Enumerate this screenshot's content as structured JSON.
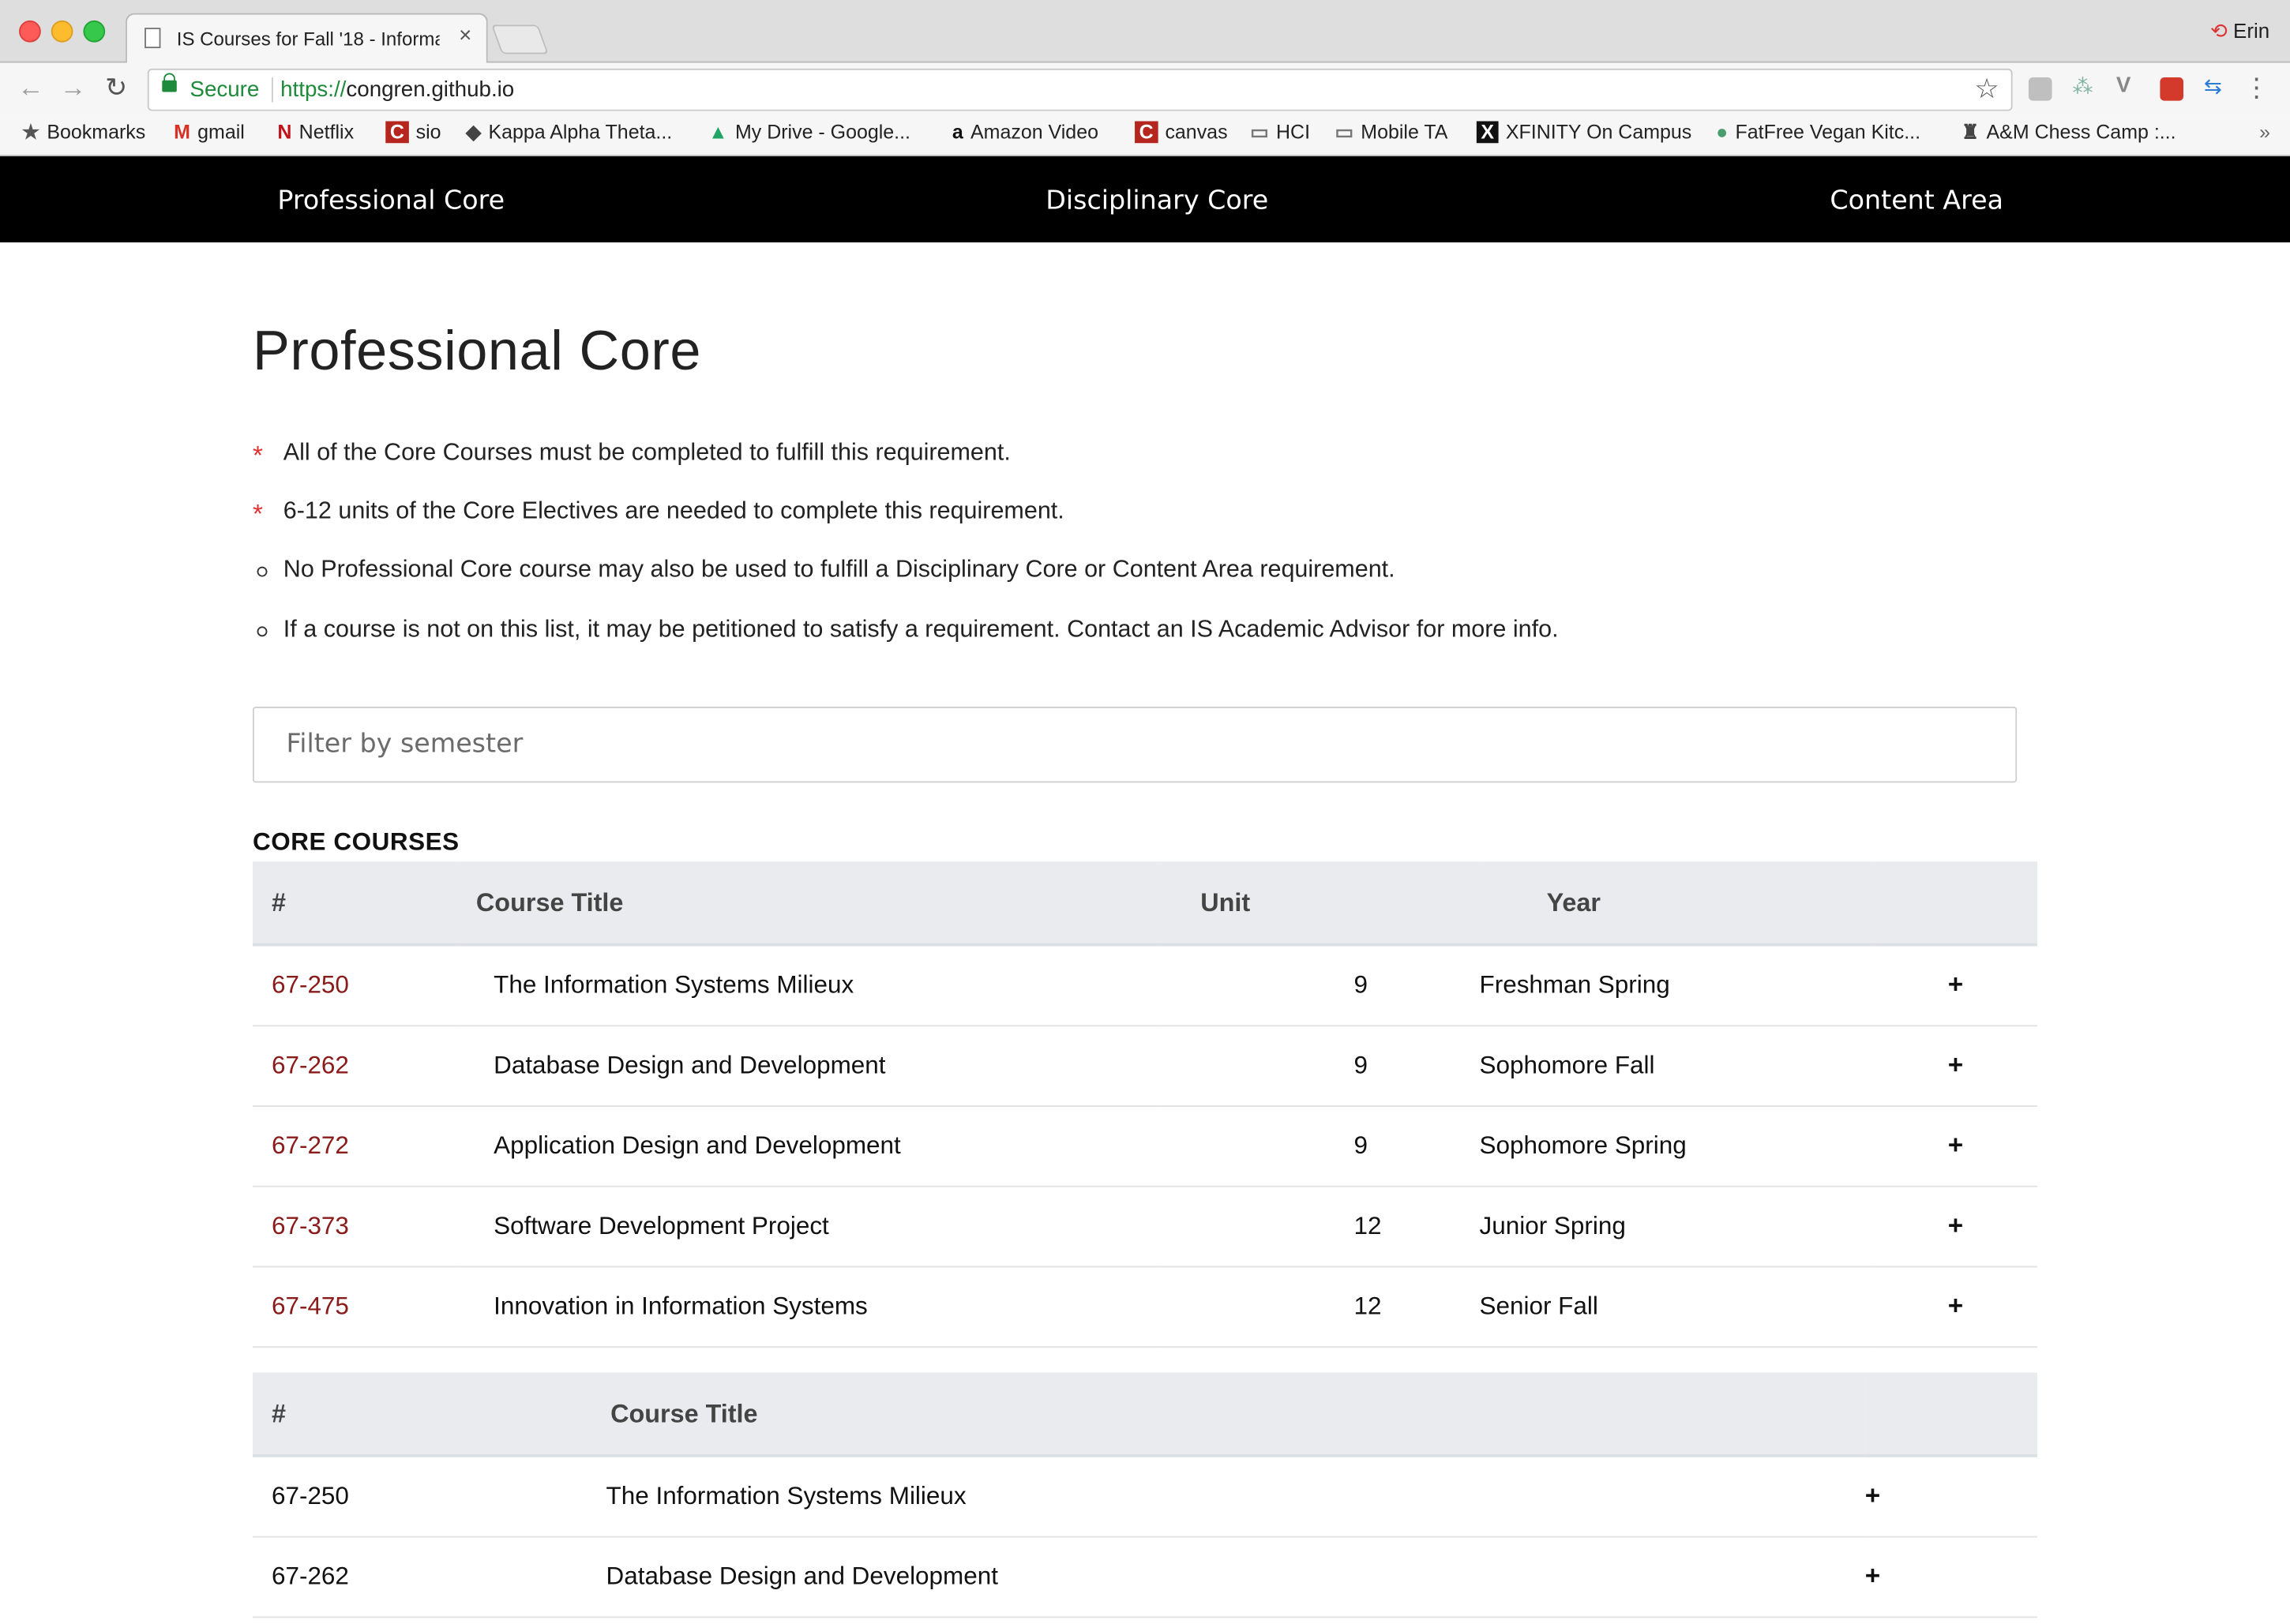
{
  "browser": {
    "tab_title": "IS Courses for Fall '18 - Informa",
    "profile_name": "Erin",
    "secure_label": "Secure",
    "url_proto": "https://",
    "url_host": "congren.github.io",
    "bookmarks": [
      {
        "label": "Bookmarks",
        "icon": "star-icon"
      },
      {
        "label": "gmail",
        "icon": "gmail-icon"
      },
      {
        "label": "Netflix",
        "icon": "netflix-icon"
      },
      {
        "label": "sio",
        "icon": "c-icon"
      },
      {
        "label": "Kappa Alpha Theta...",
        "icon": "kite-icon"
      },
      {
        "label": "My Drive - Google...",
        "icon": "drive-icon"
      },
      {
        "label": "Amazon Video",
        "icon": "amazon-icon"
      },
      {
        "label": "canvas",
        "icon": "c-icon"
      },
      {
        "label": "HCI",
        "icon": "folder-icon"
      },
      {
        "label": "Mobile TA",
        "icon": "folder-icon"
      },
      {
        "label": "XFINITY On Campus",
        "icon": "x-icon"
      },
      {
        "label": "FatFree Vegan Kitc...",
        "icon": "leaf-icon"
      },
      {
        "label": "A&M Chess Camp :...",
        "icon": "chess-icon"
      }
    ]
  },
  "nav": {
    "items": [
      "Professional Core",
      "Disciplinary Core",
      "Content Area"
    ]
  },
  "page": {
    "title": "Professional Core",
    "bullets": [
      {
        "type": "star",
        "text": "All of the Core Courses must be completed to fulfill this requirement."
      },
      {
        "type": "star",
        "text": "6-12 units of the Core Electives are needed to complete this requirement."
      },
      {
        "type": "circle",
        "text": "No Professional Core course may also be used to fulfill a Disciplinary Core or Content Area requirement."
      },
      {
        "type": "circle",
        "text": "If a course is not on this list, it may be petitioned to satisfy a requirement. Contact an IS Academic Advisor for more info."
      }
    ],
    "filter_placeholder": "Filter by semester",
    "section_heading": "CORE COURSES"
  },
  "core_table": {
    "headers": [
      "#",
      "Course Title",
      "Unit",
      "Year"
    ],
    "rows": [
      {
        "code": "67-250",
        "title": "The Information Systems Milieux",
        "unit": "9",
        "year": "Freshman Spring",
        "action": "+"
      },
      {
        "code": "67-262",
        "title": "Database Design and Development",
        "unit": "9",
        "year": "Sophomore Fall",
        "action": "+"
      },
      {
        "code": "67-272",
        "title": "Application Design and Development",
        "unit": "9",
        "year": "Sophomore Spring",
        "action": "+"
      },
      {
        "code": "67-373",
        "title": "Software Development Project",
        "unit": "12",
        "year": "Junior Spring",
        "action": "+"
      },
      {
        "code": "67-475",
        "title": "Innovation in Information Systems",
        "unit": "12",
        "year": "Senior Fall",
        "action": "+"
      }
    ]
  },
  "second_table": {
    "headers": [
      "#",
      "Course Title"
    ],
    "rows": [
      {
        "code": "67-250",
        "title": "The Information Systems Milieux",
        "action": "+"
      },
      {
        "code": "67-262",
        "title": "Database Design and Development",
        "action": "+"
      }
    ]
  }
}
